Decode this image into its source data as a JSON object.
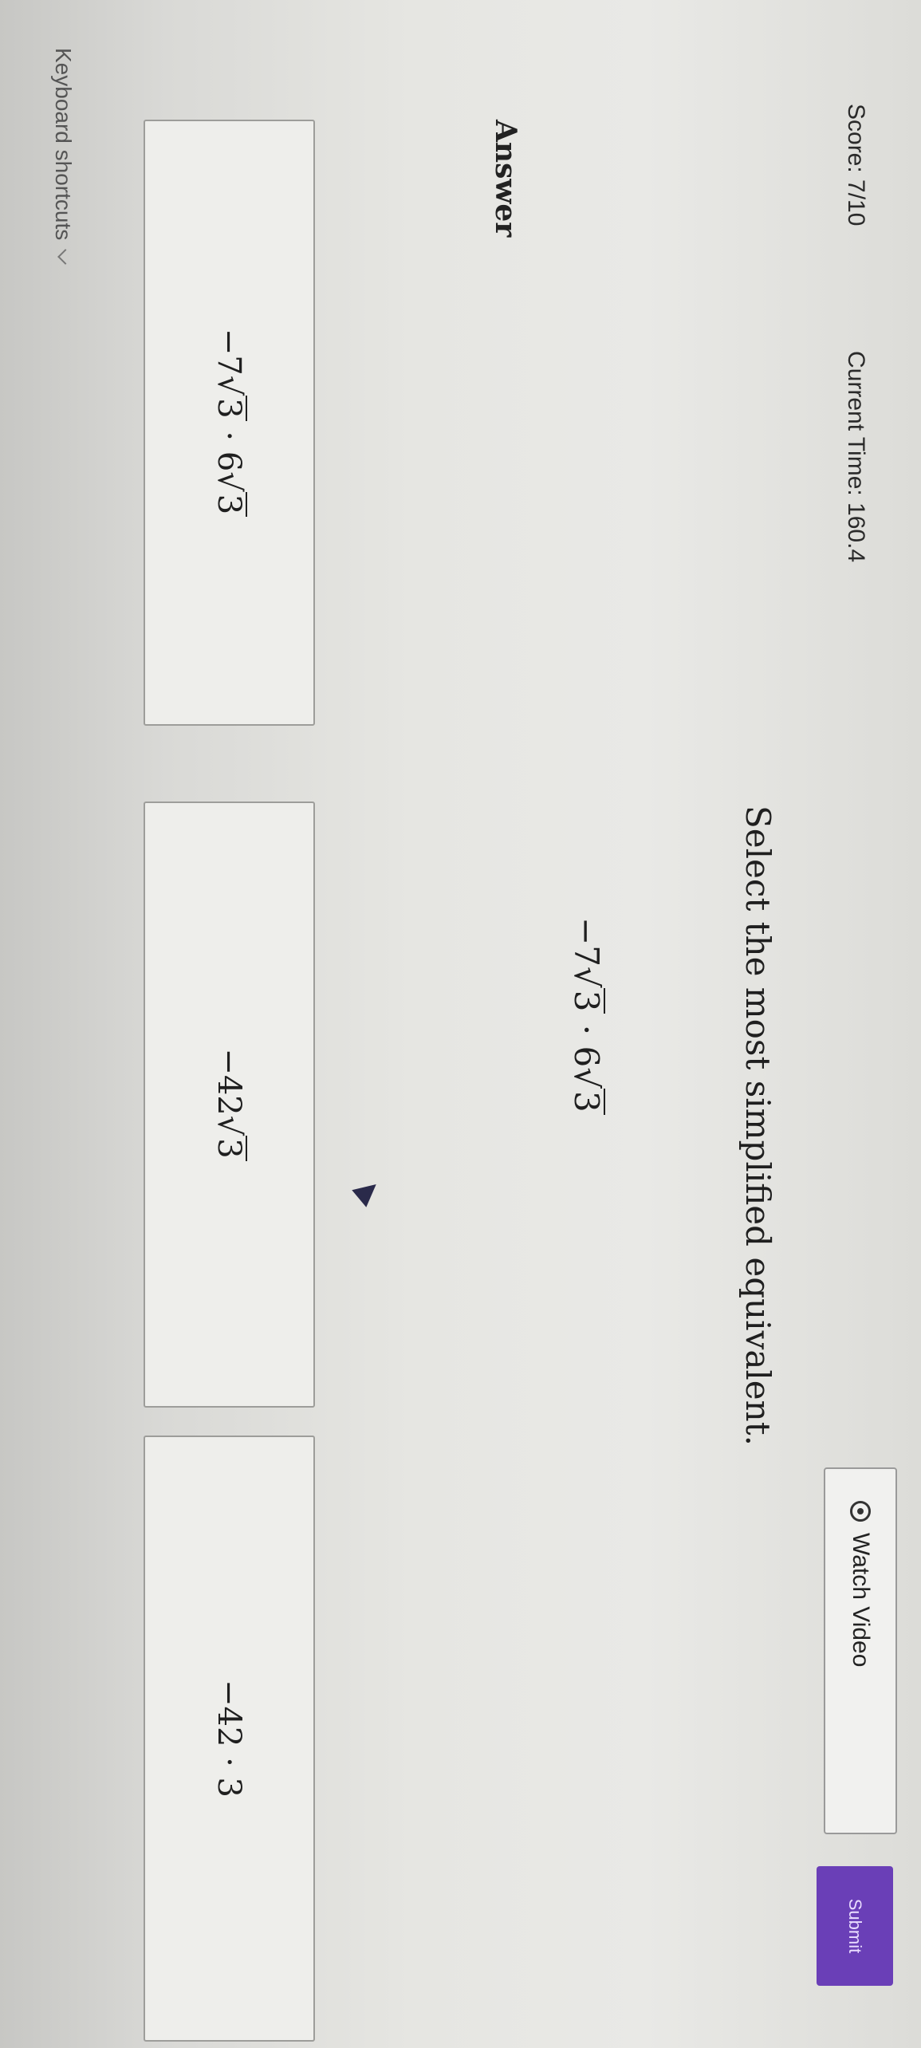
{
  "header": {
    "score": "Score: 7/10",
    "current_time": "Current Time: 160.4",
    "watch_video_label": "Watch Video",
    "submit_label": "Submit"
  },
  "question": {
    "prompt": "Select the most simplified equivalent.",
    "expression": {
      "coef1": "−7",
      "rad1": "3",
      "dot": "·",
      "coef2": "6",
      "rad2": "3"
    }
  },
  "answer_label": "Answer",
  "choices": [
    {
      "coef1": "−7",
      "rad1": "3",
      "dot": "·",
      "coef2": "6",
      "rad2": "3"
    },
    {
      "coef": "−42",
      "rad": "3"
    },
    {
      "text": "−42 · 3"
    }
  ],
  "footer": {
    "keyboard_shortcuts_label": "Keyboard shortcuts"
  },
  "icons": {
    "watch_video": "radio-dot-icon",
    "keyboard_shortcuts": "chevron-down-icon",
    "cursor": "mouse-pointer-icon"
  }
}
